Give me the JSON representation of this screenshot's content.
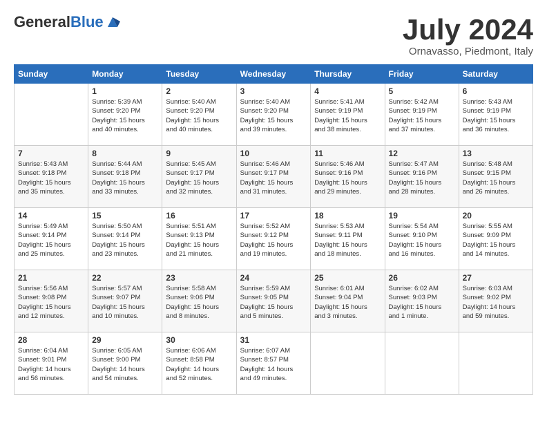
{
  "header": {
    "logo_general": "General",
    "logo_blue": "Blue",
    "month_title": "July 2024",
    "location": "Ornavasso, Piedmont, Italy"
  },
  "columns": [
    "Sunday",
    "Monday",
    "Tuesday",
    "Wednesday",
    "Thursday",
    "Friday",
    "Saturday"
  ],
  "weeks": [
    [
      {
        "day": "",
        "info": ""
      },
      {
        "day": "1",
        "info": "Sunrise: 5:39 AM\nSunset: 9:20 PM\nDaylight: 15 hours\nand 40 minutes."
      },
      {
        "day": "2",
        "info": "Sunrise: 5:40 AM\nSunset: 9:20 PM\nDaylight: 15 hours\nand 40 minutes."
      },
      {
        "day": "3",
        "info": "Sunrise: 5:40 AM\nSunset: 9:20 PM\nDaylight: 15 hours\nand 39 minutes."
      },
      {
        "day": "4",
        "info": "Sunrise: 5:41 AM\nSunset: 9:19 PM\nDaylight: 15 hours\nand 38 minutes."
      },
      {
        "day": "5",
        "info": "Sunrise: 5:42 AM\nSunset: 9:19 PM\nDaylight: 15 hours\nand 37 minutes."
      },
      {
        "day": "6",
        "info": "Sunrise: 5:43 AM\nSunset: 9:19 PM\nDaylight: 15 hours\nand 36 minutes."
      }
    ],
    [
      {
        "day": "7",
        "info": "Sunrise: 5:43 AM\nSunset: 9:18 PM\nDaylight: 15 hours\nand 35 minutes."
      },
      {
        "day": "8",
        "info": "Sunrise: 5:44 AM\nSunset: 9:18 PM\nDaylight: 15 hours\nand 33 minutes."
      },
      {
        "day": "9",
        "info": "Sunrise: 5:45 AM\nSunset: 9:17 PM\nDaylight: 15 hours\nand 32 minutes."
      },
      {
        "day": "10",
        "info": "Sunrise: 5:46 AM\nSunset: 9:17 PM\nDaylight: 15 hours\nand 31 minutes."
      },
      {
        "day": "11",
        "info": "Sunrise: 5:46 AM\nSunset: 9:16 PM\nDaylight: 15 hours\nand 29 minutes."
      },
      {
        "day": "12",
        "info": "Sunrise: 5:47 AM\nSunset: 9:16 PM\nDaylight: 15 hours\nand 28 minutes."
      },
      {
        "day": "13",
        "info": "Sunrise: 5:48 AM\nSunset: 9:15 PM\nDaylight: 15 hours\nand 26 minutes."
      }
    ],
    [
      {
        "day": "14",
        "info": "Sunrise: 5:49 AM\nSunset: 9:14 PM\nDaylight: 15 hours\nand 25 minutes."
      },
      {
        "day": "15",
        "info": "Sunrise: 5:50 AM\nSunset: 9:14 PM\nDaylight: 15 hours\nand 23 minutes."
      },
      {
        "day": "16",
        "info": "Sunrise: 5:51 AM\nSunset: 9:13 PM\nDaylight: 15 hours\nand 21 minutes."
      },
      {
        "day": "17",
        "info": "Sunrise: 5:52 AM\nSunset: 9:12 PM\nDaylight: 15 hours\nand 19 minutes."
      },
      {
        "day": "18",
        "info": "Sunrise: 5:53 AM\nSunset: 9:11 PM\nDaylight: 15 hours\nand 18 minutes."
      },
      {
        "day": "19",
        "info": "Sunrise: 5:54 AM\nSunset: 9:10 PM\nDaylight: 15 hours\nand 16 minutes."
      },
      {
        "day": "20",
        "info": "Sunrise: 5:55 AM\nSunset: 9:09 PM\nDaylight: 15 hours\nand 14 minutes."
      }
    ],
    [
      {
        "day": "21",
        "info": "Sunrise: 5:56 AM\nSunset: 9:08 PM\nDaylight: 15 hours\nand 12 minutes."
      },
      {
        "day": "22",
        "info": "Sunrise: 5:57 AM\nSunset: 9:07 PM\nDaylight: 15 hours\nand 10 minutes."
      },
      {
        "day": "23",
        "info": "Sunrise: 5:58 AM\nSunset: 9:06 PM\nDaylight: 15 hours\nand 8 minutes."
      },
      {
        "day": "24",
        "info": "Sunrise: 5:59 AM\nSunset: 9:05 PM\nDaylight: 15 hours\nand 5 minutes."
      },
      {
        "day": "25",
        "info": "Sunrise: 6:01 AM\nSunset: 9:04 PM\nDaylight: 15 hours\nand 3 minutes."
      },
      {
        "day": "26",
        "info": "Sunrise: 6:02 AM\nSunset: 9:03 PM\nDaylight: 15 hours\nand 1 minute."
      },
      {
        "day": "27",
        "info": "Sunrise: 6:03 AM\nSunset: 9:02 PM\nDaylight: 14 hours\nand 59 minutes."
      }
    ],
    [
      {
        "day": "28",
        "info": "Sunrise: 6:04 AM\nSunset: 9:01 PM\nDaylight: 14 hours\nand 56 minutes."
      },
      {
        "day": "29",
        "info": "Sunrise: 6:05 AM\nSunset: 9:00 PM\nDaylight: 14 hours\nand 54 minutes."
      },
      {
        "day": "30",
        "info": "Sunrise: 6:06 AM\nSunset: 8:58 PM\nDaylight: 14 hours\nand 52 minutes."
      },
      {
        "day": "31",
        "info": "Sunrise: 6:07 AM\nSunset: 8:57 PM\nDaylight: 14 hours\nand 49 minutes."
      },
      {
        "day": "",
        "info": ""
      },
      {
        "day": "",
        "info": ""
      },
      {
        "day": "",
        "info": ""
      }
    ]
  ]
}
